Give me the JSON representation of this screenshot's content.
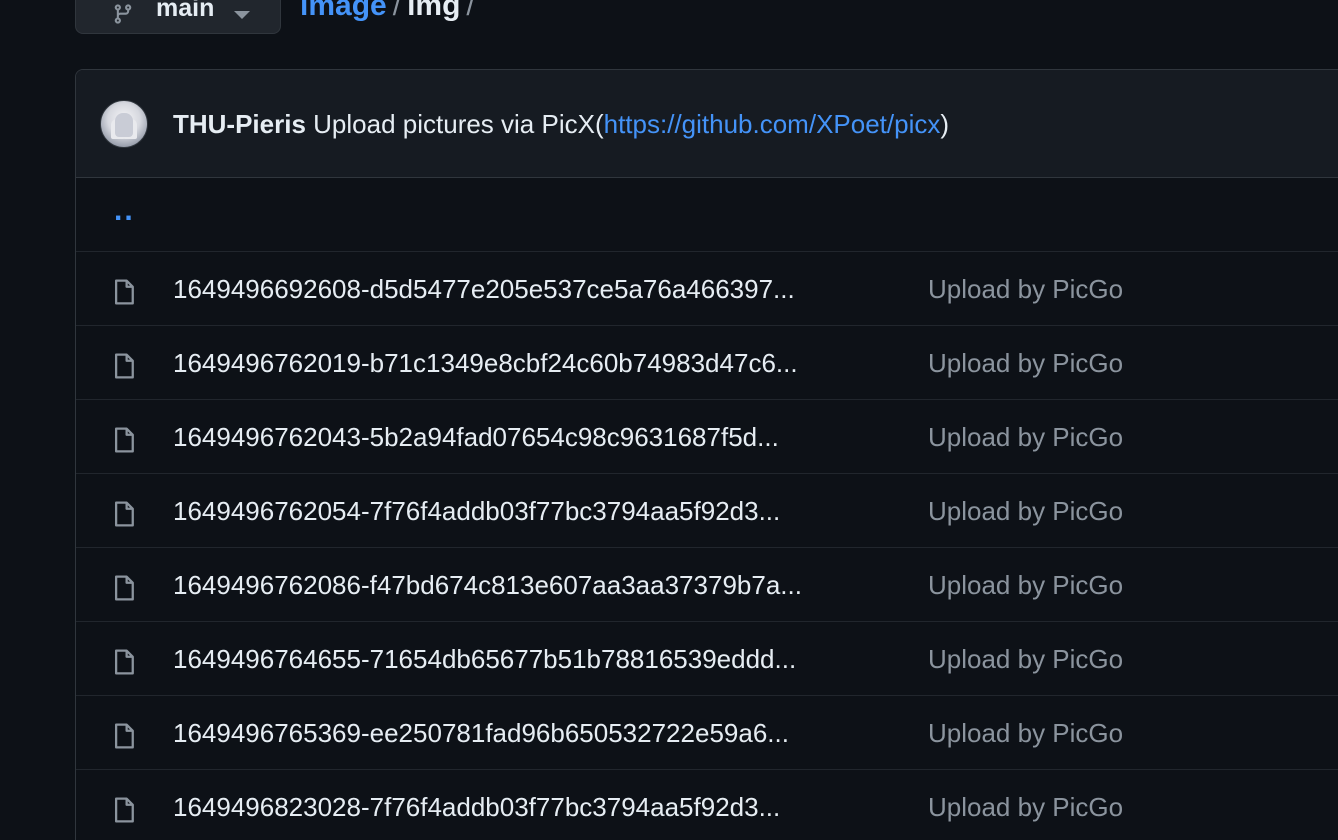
{
  "branch": {
    "label": "main"
  },
  "breadcrumb": {
    "repo": "image",
    "separator": "/",
    "folder": "img",
    "trailing": "/"
  },
  "commit": {
    "author": "THU-Pieris",
    "message": "Upload pictures via PicX(",
    "link": "https://github.com/XPoet/picx",
    "message_end": ")"
  },
  "parent_dir": "..",
  "files": [
    {
      "name": "1649496692608-d5d5477e205e537ce5a76a466397...",
      "commit": "Upload by PicGo"
    },
    {
      "name": "1649496762019-b71c1349e8cbf24c60b74983d47c6...",
      "commit": "Upload by PicGo"
    },
    {
      "name": "1649496762043-5b2a94fad07654c98c9631687f5d...",
      "commit": "Upload by PicGo"
    },
    {
      "name": "1649496762054-7f76f4addb03f77bc3794aa5f92d3...",
      "commit": "Upload by PicGo"
    },
    {
      "name": "1649496762086-f47bd674c813e607aa3aa37379b7a...",
      "commit": "Upload by PicGo"
    },
    {
      "name": "1649496764655-71654db65677b51b78816539eddd...",
      "commit": "Upload by PicGo"
    },
    {
      "name": "1649496765369-ee250781fad96b650532722e59a6...",
      "commit": "Upload by PicGo"
    },
    {
      "name": "1649496823028-7f76f4addb03f77bc3794aa5f92d3...",
      "commit": "Upload by PicGo"
    }
  ],
  "icons": {
    "branch": "git-branch-icon",
    "caret": "caret-down-icon",
    "file": "file-icon"
  },
  "colors": {
    "background": "#0d1117",
    "link": "#4493f8",
    "muted": "#8b949e",
    "border": "#30363d"
  }
}
